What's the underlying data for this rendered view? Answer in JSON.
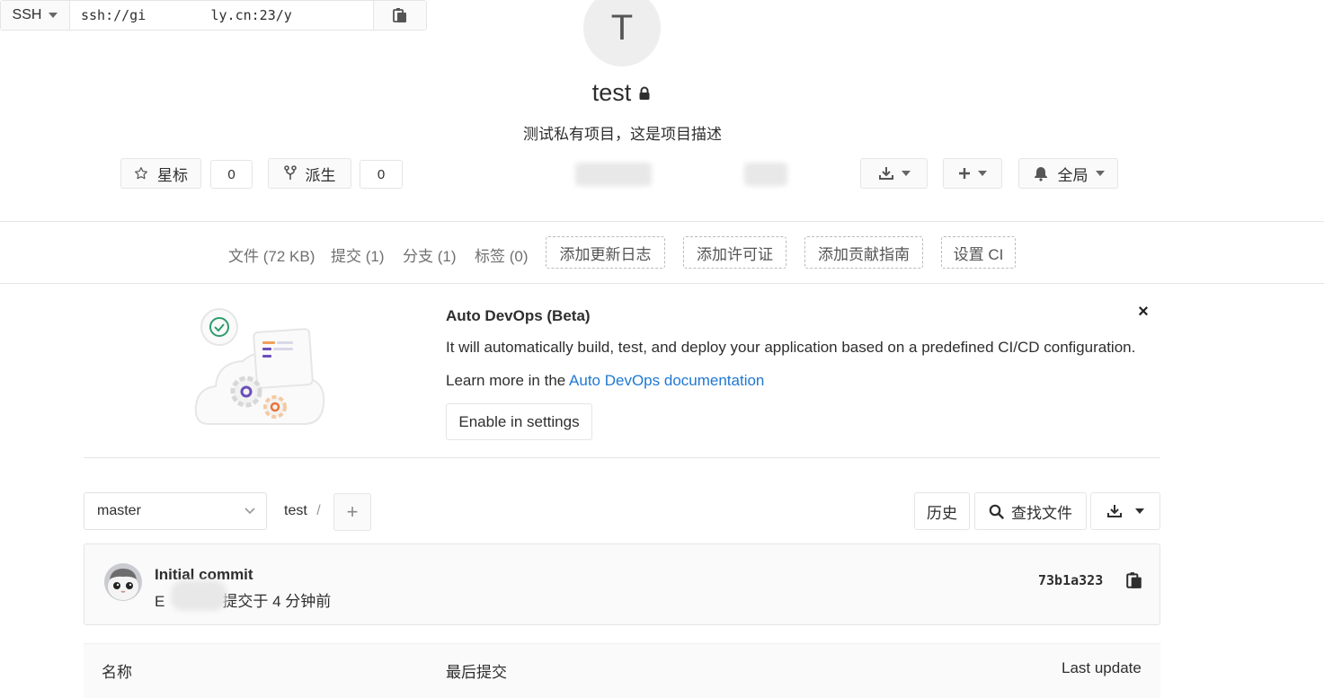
{
  "project": {
    "avatar_letter": "T",
    "name": "test",
    "description": "测试私有项目，这是项目描述"
  },
  "actions": {
    "star_label": "星标",
    "star_count": "0",
    "fork_label": "派生",
    "fork_count": "0",
    "clone_protocol": "SSH",
    "clone_url": "ssh://gi        ly.cn:23/y",
    "notification_label": "全局"
  },
  "stats": {
    "files": "文件 (72 KB)",
    "commits": "提交 (1)",
    "branches": "分支 (1)",
    "tags": "标签 (0)",
    "add_changelog": "添加更新日志",
    "add_license": "添加许可证",
    "add_contributing": "添加贡献指南",
    "setup_ci": "设置 CI"
  },
  "banner": {
    "title": "Auto DevOps (Beta)",
    "text": "It will automatically build, test, and deploy your application based on a predefined CI/CD configuration.",
    "learn_prefix": "Learn more in the ",
    "learn_link": "Auto DevOps documentation",
    "enable_button": "Enable in settings",
    "close": "×"
  },
  "repo": {
    "branch": "master",
    "path_root": "test",
    "path_sep": "/",
    "add_button": "+",
    "history_button": "历史",
    "find_file_button": "查找文件"
  },
  "commit": {
    "message": "Initial commit",
    "author_initial": "E",
    "meta_suffix": "提交于 4 分钟前",
    "sha": "73b1a323"
  },
  "table": {
    "col_name": "名称",
    "col_last_commit": "最后提交",
    "col_last_update": "Last update"
  },
  "colors": {
    "link": "#1f78d1",
    "border": "#e5e5e5",
    "panel_bg": "#fafafa"
  }
}
